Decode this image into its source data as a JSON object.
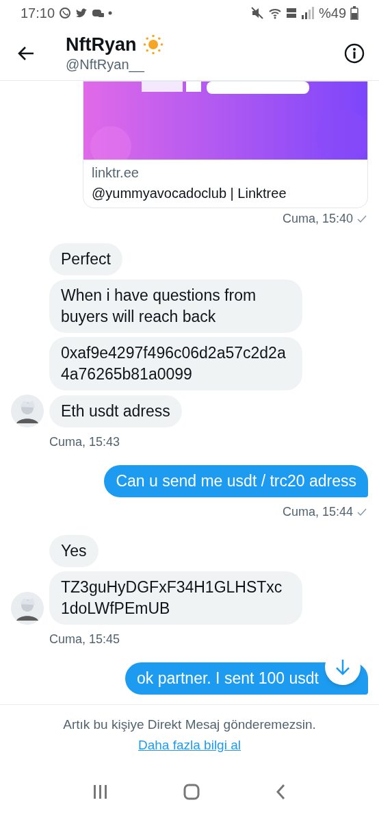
{
  "status_bar": {
    "time": "17:10",
    "battery": "%49"
  },
  "header": {
    "name": "NftRyan",
    "handle": "@NftRyan__"
  },
  "messages": [
    {
      "kind": "link_card",
      "outgoing": true,
      "domain": "linktr.ee",
      "title": "@yummyavocadoclub | Linktree",
      "time": "Cuma, 15:40"
    },
    {
      "kind": "group",
      "outgoing": false,
      "texts": [
        "Perfect",
        "When i have questions from buyers will reach back",
        "0xaf9e4297f496c06d2a57c2d2a4a76265b81a0099",
        "Eth usdt adress"
      ],
      "time": "Cuma, 15:43"
    },
    {
      "kind": "group",
      "outgoing": true,
      "texts": [
        "Can u send me usdt / trc20 adress"
      ],
      "time": "Cuma, 15:44"
    },
    {
      "kind": "group",
      "outgoing": false,
      "texts": [
        "Yes",
        "TZ3guHyDGFxF34H1GLHSTxc1doLWfPEmUB"
      ],
      "time": "Cuma, 15:45"
    },
    {
      "kind": "group",
      "outgoing": true,
      "texts": [
        "ok partner. I sent 100 usdt"
      ]
    }
  ],
  "notice": {
    "text": "Artık bu kişiye Direkt Mesaj gönderemezsin.",
    "link": "Daha fazla bilgi al"
  }
}
